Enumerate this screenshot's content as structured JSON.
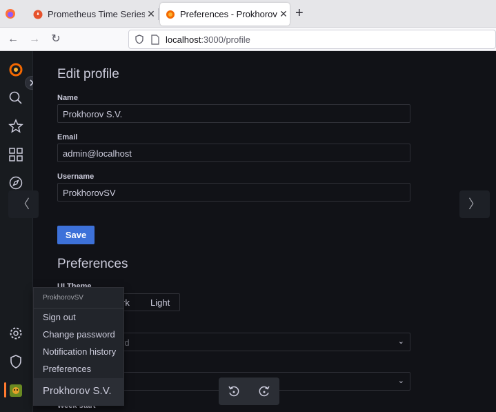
{
  "browser": {
    "tabs": [
      {
        "title": "Prometheus Time Series"
      },
      {
        "title": "Preferences - Prokhorov"
      }
    ],
    "url_host": "localhost",
    "url_path": ":3000/profile"
  },
  "profile": {
    "title": "Edit profile",
    "name_label": "Name",
    "name_value": "Prokhorov S.V.",
    "email_label": "Email",
    "email_value": "admin@localhost",
    "username_label": "Username",
    "username_value": "ProkhorovSV",
    "save_label": "Save"
  },
  "preferences": {
    "title": "Preferences",
    "ui_theme_label": "UI Theme",
    "theme_options": [
      "rk",
      "Light"
    ],
    "home_dashboard_placeholder": "rd",
    "week_start_label": "Week start"
  },
  "user_menu": {
    "username": "ProkhorovSV",
    "items": [
      "Sign out",
      "Change password",
      "Notification history",
      "Preferences"
    ],
    "display_name": "Prokhorov S.V."
  },
  "colors": {
    "accent": "#3d71d9",
    "grafana_orange": "#ff7a2e",
    "background": "#111217"
  }
}
